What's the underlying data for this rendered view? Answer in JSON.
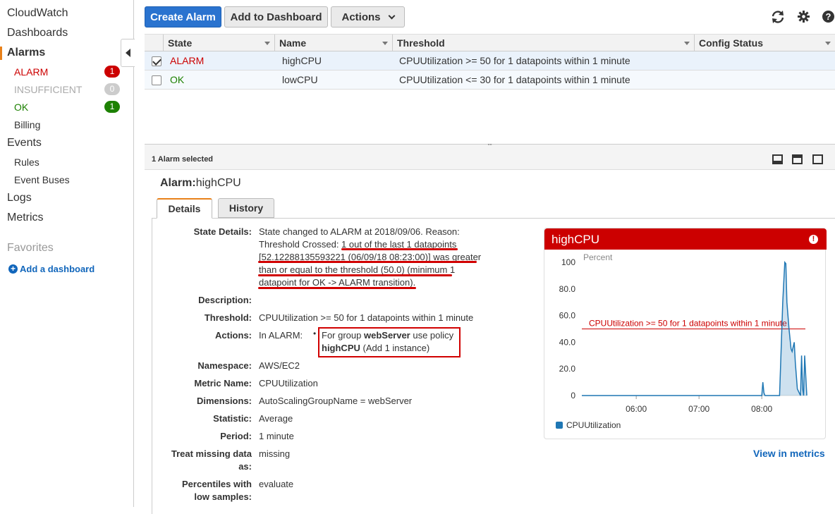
{
  "sidebar": {
    "cloudwatch": "CloudWatch",
    "dashboards": "Dashboards",
    "alarms": "Alarms",
    "alarm_states": [
      {
        "label": "ALARM",
        "count": "1",
        "color": "#cc0000",
        "badge_color": "#cc0000"
      },
      {
        "label": "INSUFFICIENT",
        "count": "0",
        "color": "#aaaaaa",
        "badge_color": "#cccccc"
      },
      {
        "label": "OK",
        "count": "1",
        "color": "#1d8102",
        "badge_color": "#1d8102"
      }
    ],
    "billing": "Billing",
    "events": "Events",
    "rules": "Rules",
    "event_buses": "Event Buses",
    "logs": "Logs",
    "metrics": "Metrics",
    "favorites": "Favorites",
    "add_dashboard": "Add a dashboard"
  },
  "toolbar": {
    "create_alarm": "Create Alarm",
    "add_to_dashboard": "Add to Dashboard",
    "actions": "Actions"
  },
  "table": {
    "headers": [
      "State",
      "Name",
      "Threshold",
      "Config Status"
    ],
    "rows": [
      {
        "state": "ALARM",
        "state_color": "#cc0000",
        "name": "highCPU",
        "threshold": "CPUUtilization >= 50 for 1 datapoints within 1 minute",
        "checked": true
      },
      {
        "state": "OK",
        "state_color": "#1d8102",
        "name": "lowCPU",
        "threshold": "CPUUtilization <= 30 for 1 datapoints within 1 minute",
        "checked": false
      }
    ]
  },
  "selection": {
    "count_text": "1 Alarm selected",
    "title_label": "Alarm:",
    "title_value": "highCPU"
  },
  "tabs": {
    "details": "Details",
    "history": "History"
  },
  "details": {
    "state_details_label": "State Details:",
    "state_details_lines": [
      "State changed to ALARM at 2018/09/06. Reason:",
      "Threshold Crossed: 1 out of the last 1 datapoints",
      "[52.12288135593221 (06/09/18 08:23:00)] was greater",
      "than or equal to the threshold (50.0) (minimum 1",
      "datapoint for OK -> ALARM transition)."
    ],
    "description_label": "Description:",
    "description": "",
    "threshold_label": "Threshold:",
    "threshold": "CPUUtilization >= 50 for 1 datapoints within 1 minute",
    "actions_label": "Actions:",
    "actions_state": "In ALARM:",
    "actions_line1_pre": "For group ",
    "actions_line1_bold": "webServer",
    "actions_line1_post": " use policy",
    "actions_line2_bold": "highCPU",
    "actions_line2_post": " (Add 1 instance)",
    "namespace_label": "Namespace:",
    "namespace": "AWS/EC2",
    "metric_name_label": "Metric Name:",
    "metric_name": "CPUUtilization",
    "dimensions_label": "Dimensions:",
    "dimensions": "AutoScalingGroupName = webServer",
    "statistic_label": "Statistic:",
    "statistic": "Average",
    "period_label": "Period:",
    "period": "1 minute",
    "treat_missing_label_1": "Treat missing data",
    "treat_missing_label_2": "as:",
    "treat_missing": "missing",
    "percentiles_label_1": "Percentiles with",
    "percentiles_label_2": "low samples:",
    "percentiles": "evaluate"
  },
  "chart_data": {
    "type": "line",
    "title": "highCPU",
    "ylabel": "Percent",
    "ylim": [
      0,
      100
    ],
    "yticks": [
      "100",
      "80.0",
      "60.0",
      "40.0",
      "20.0",
      "0"
    ],
    "xticks": [
      "06:00",
      "07:00",
      "08:00"
    ],
    "threshold_label": "CPUUtilization >= 50 for 1 datapoints within 1 minute",
    "threshold": 50,
    "series": [
      {
        "name": "CPUUtilization",
        "color": "#1f77b4",
        "x": [
          "05:08",
          "08:00",
          "08:01",
          "08:02",
          "08:03",
          "08:04",
          "08:05",
          "08:10",
          "08:14",
          "08:17",
          "08:20",
          "08:22",
          "08:23",
          "08:24",
          "08:26",
          "08:28",
          "08:29",
          "08:31",
          "08:32",
          "08:34",
          "08:37",
          "08:38",
          "08:39",
          "08:40",
          "08:41",
          "08:43"
        ],
        "y": [
          0,
          0,
          10,
          2,
          0,
          0,
          0,
          0,
          0,
          0,
          70,
          100,
          99,
          70,
          50,
          35,
          33,
          40,
          25,
          5,
          0,
          30,
          5,
          0,
          30,
          0
        ]
      }
    ],
    "legend": [
      "CPUUtilization"
    ]
  },
  "links": {
    "view_in_metrics": "View in metrics"
  }
}
